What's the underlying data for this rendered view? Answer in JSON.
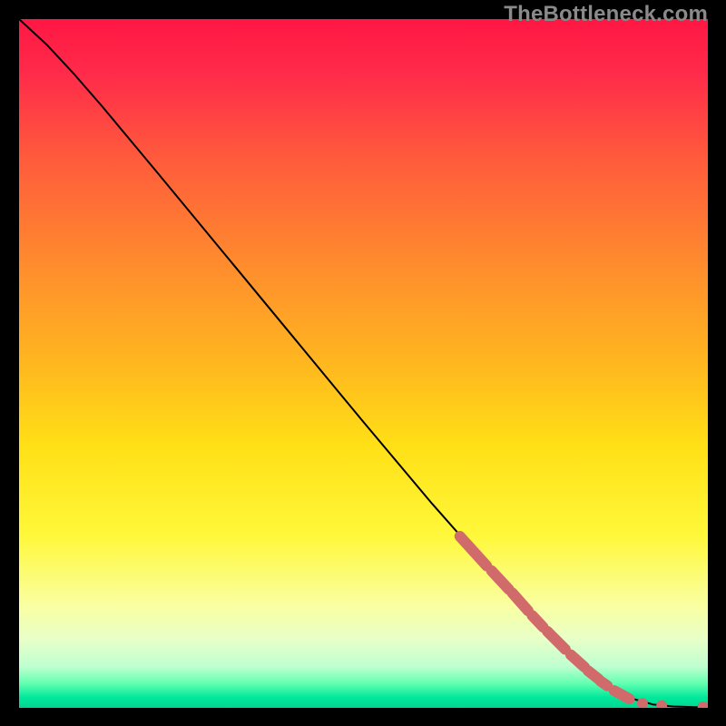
{
  "watermark": "TheBottleneck.com",
  "colors": {
    "curve": "#000000",
    "marker": "#d16a6a"
  },
  "chart_data": {
    "type": "line",
    "title": "",
    "xlabel": "",
    "ylabel": "",
    "xlim": [
      0,
      100
    ],
    "ylim": [
      0,
      100
    ],
    "curve": [
      {
        "x": 0.0,
        "y": 100.0
      },
      {
        "x": 4.0,
        "y": 96.3
      },
      {
        "x": 8.0,
        "y": 92.0
      },
      {
        "x": 12.0,
        "y": 87.4
      },
      {
        "x": 20.0,
        "y": 77.8
      },
      {
        "x": 30.0,
        "y": 65.7
      },
      {
        "x": 40.0,
        "y": 53.6
      },
      {
        "x": 50.0,
        "y": 41.5
      },
      {
        "x": 60.0,
        "y": 29.6
      },
      {
        "x": 66.0,
        "y": 22.8
      },
      {
        "x": 70.0,
        "y": 18.4
      },
      {
        "x": 75.0,
        "y": 12.9
      },
      {
        "x": 80.0,
        "y": 7.8
      },
      {
        "x": 84.0,
        "y": 4.4
      },
      {
        "x": 87.0,
        "y": 2.4
      },
      {
        "x": 89.5,
        "y": 1.2
      },
      {
        "x": 92.0,
        "y": 0.5
      },
      {
        "x": 95.0,
        "y": 0.2
      },
      {
        "x": 98.0,
        "y": 0.1
      },
      {
        "x": 100.0,
        "y": 0.1
      }
    ],
    "marker_segments": [
      {
        "x0": 64.0,
        "y0": 24.9,
        "x1": 67.9,
        "y1": 20.6
      },
      {
        "x0": 68.6,
        "y0": 19.9,
        "x1": 71.1,
        "y1": 17.2
      },
      {
        "x0": 71.6,
        "y0": 16.7,
        "x1": 73.9,
        "y1": 14.1
      },
      {
        "x0": 74.5,
        "y0": 13.4,
        "x1": 76.1,
        "y1": 11.7
      },
      {
        "x0": 76.7,
        "y0": 11.1,
        "x1": 79.3,
        "y1": 8.5
      },
      {
        "x0": 80.1,
        "y0": 7.7,
        "x1": 82.1,
        "y1": 5.9
      },
      {
        "x0": 82.6,
        "y0": 5.4,
        "x1": 84.1,
        "y1": 4.2
      },
      {
        "x0": 84.4,
        "y0": 3.9,
        "x1": 85.4,
        "y1": 3.2
      },
      {
        "x0": 86.4,
        "y0": 2.5,
        "x1": 88.6,
        "y1": 1.3
      }
    ],
    "marker_points": [
      {
        "x": 90.5,
        "y": 0.65
      },
      {
        "x": 93.3,
        "y": 0.3
      },
      {
        "x": 99.3,
        "y": 0.15
      }
    ]
  }
}
